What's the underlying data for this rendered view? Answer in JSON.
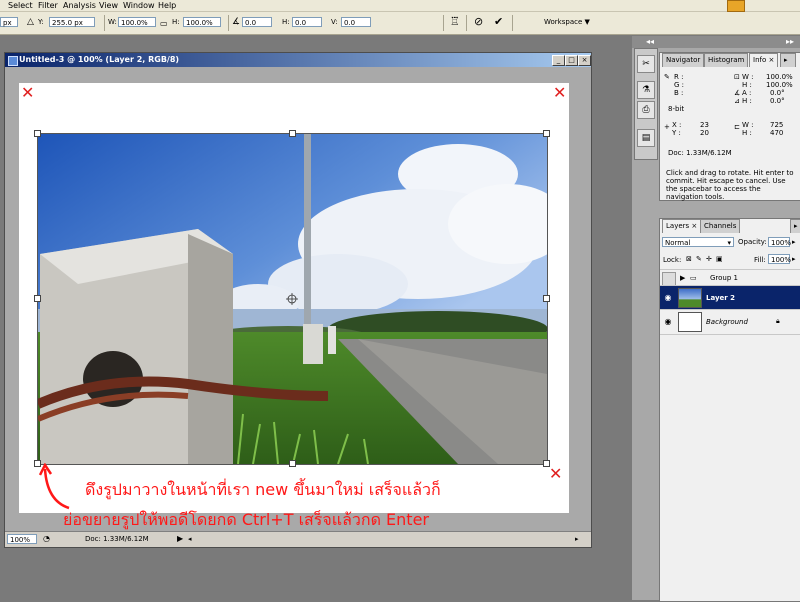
{
  "menu": {
    "items": [
      "Select",
      "Filter",
      "Analysis",
      "View",
      "Window",
      "Help"
    ]
  },
  "options_bar": {
    "x_value": "px",
    "y_label": "Y:",
    "y_value": "255.0 px",
    "w_label": "W:",
    "w_value": "100.0%",
    "h_label": "H:",
    "h_value": "100.0%",
    "angle_value": "0.0",
    "hskew_label": "H:",
    "hskew_value": "0.0",
    "vskew_label": "V:",
    "vskew_value": "0.0",
    "workspace_label": "Workspace"
  },
  "document": {
    "title": "Untitled-3 @ 100% (Layer 2, RGB/8)",
    "zoom": "100%",
    "doc_size": "Doc: 1.33M/6.12M",
    "annotation_line1": "ดึงรูปมาวางในหน้าที่เรา new ขึ้นมาใหม่ เสร็จแล้วก็",
    "annotation_line2": "ย่อขยายรูปให้พอดีโดยกด Ctrl+T เสร็จแล้วกด Enter"
  },
  "info_panel": {
    "tabs": [
      "Navigator",
      "Histogram",
      "Info"
    ],
    "active_tab": "Info",
    "r_label": "R :",
    "g_label": "G :",
    "b_label": "B :",
    "bit_depth": "8-bit",
    "w_label": "W :",
    "w_value": "100.0%",
    "h_label": "H :",
    "h_value": "100.0%",
    "a_label": "A :",
    "a_value": "0.0°",
    "h2_label": "H :",
    "h2_value": "0.0°",
    "x_label": "X :",
    "x_value": "23",
    "y_label": "Y :",
    "y_value": "20",
    "sel_w_label": "W :",
    "sel_w_value": "725",
    "sel_h_label": "H :",
    "sel_h_value": "470",
    "doc_size": "Doc: 1.33M/6.12M",
    "hint": "Click and drag to rotate. Hit enter to commit. Hit escape to cancel. Use the spacebar to access the navigation tools."
  },
  "layers_panel": {
    "tabs": [
      "Layers",
      "Channels"
    ],
    "active_tab": "Layers",
    "blend_mode": "Normal",
    "opacity_label": "Opacity:",
    "opacity_value": "100%",
    "lock_label": "Lock:",
    "fill_label": "Fill:",
    "fill_value": "100%",
    "layers": [
      {
        "name": "Group 1"
      },
      {
        "name": "Layer 2"
      },
      {
        "name": "Background"
      }
    ]
  },
  "colors": {
    "accent": "#0a246a",
    "annotation": "#ff1818"
  }
}
